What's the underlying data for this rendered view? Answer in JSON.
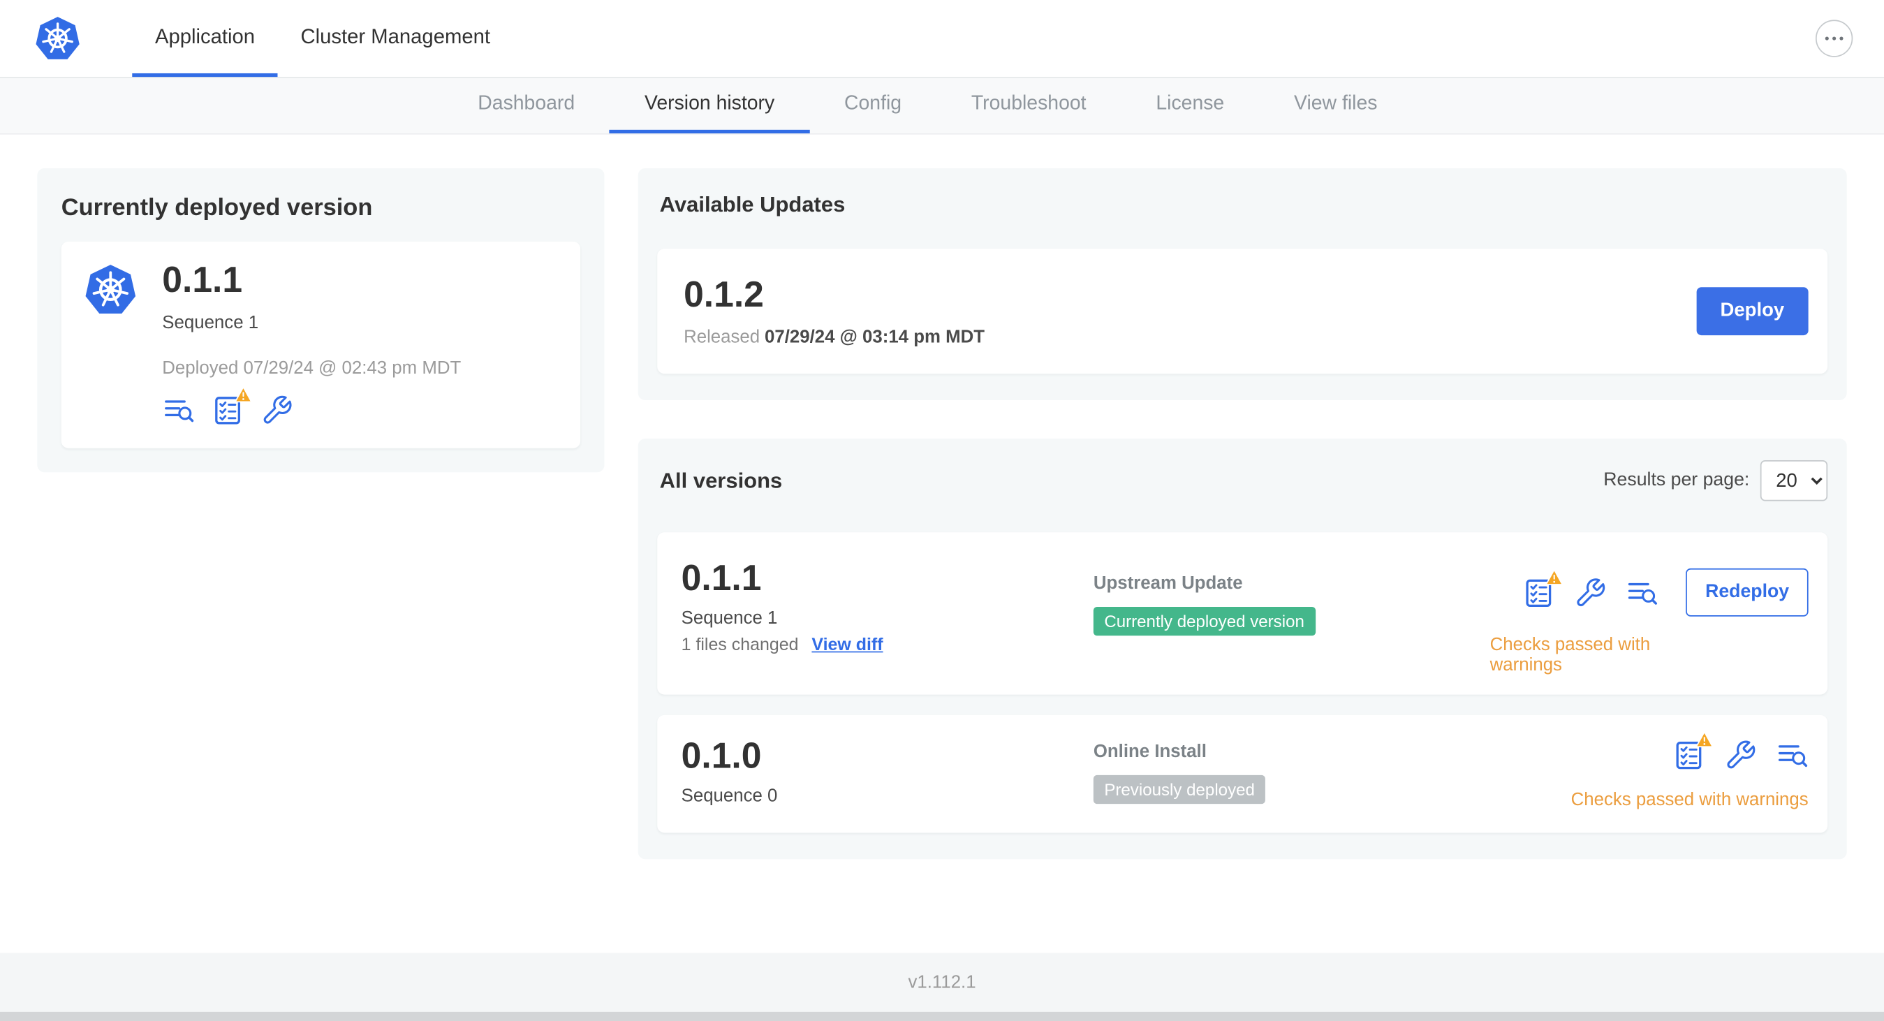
{
  "colors": {
    "accent": "#326de6",
    "button_blue": "#3b6fe6",
    "badge_green": "#44b78b",
    "badge_gray": "#bcc1c4",
    "warning_orange": "#eb9d3e",
    "warning_yellow": "#f5a623",
    "card_bg": "#f5f8f9"
  },
  "icons": {
    "brand": "kubernetes-logo",
    "more": "ellipsis",
    "release_notes": "text-lines-with-magnifier",
    "preflight_checks": "checklist-with-warning-triangle",
    "config": "wrench"
  },
  "topnav": {
    "tabs": [
      {
        "label": "Application",
        "active": true
      },
      {
        "label": "Cluster Management",
        "active": false
      }
    ]
  },
  "subnav": {
    "items": [
      "Dashboard",
      "Version history",
      "Config",
      "Troubleshoot",
      "License",
      "View files"
    ],
    "active_item": "Version history"
  },
  "current_version": {
    "title": "Currently deployed version",
    "version": "0.1.1",
    "sequence": "Sequence 1",
    "deployed_at": "Deployed 07/29/24 @ 02:43 pm MDT"
  },
  "available_updates": {
    "title": "Available Updates",
    "version": "0.1.2",
    "released_label": "Released",
    "released_date": "07/29/24 @ 03:14 pm MDT",
    "deploy_button": "Deploy"
  },
  "all_versions": {
    "title": "All versions",
    "results_per_page_label": "Results per page:",
    "results_per_page_value": "20",
    "rows": [
      {
        "version": "0.1.1",
        "sequence": "Sequence 1",
        "files_changed": "1 files changed",
        "view_diff_link": "View diff",
        "source_label": "Upstream Update",
        "badge": "Currently deployed version",
        "badge_style": "green",
        "status": "Checks passed with warnings",
        "redeploy_button": "Redeploy"
      },
      {
        "version": "0.1.0",
        "sequence": "Sequence 0",
        "source_label": "Online Install",
        "badge": "Previously deployed",
        "badge_style": "gray",
        "status": "Checks passed with warnings"
      }
    ]
  },
  "footer": {
    "app_version": "v1.112.1"
  }
}
